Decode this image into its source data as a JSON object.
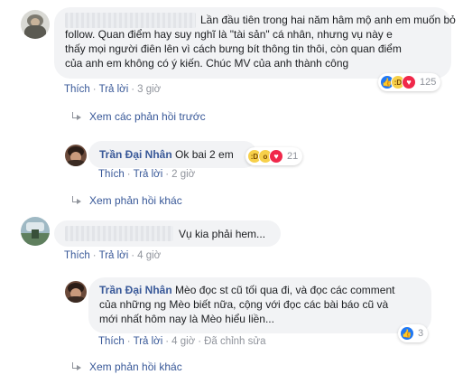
{
  "comment1": {
    "text": "Lần đầu tiên trong hai năm hâm mộ anh em muốn bỏ follow. Quan điểm hay suy nghĩ là \"tài sản\" cá nhân, nhưng vụ này e thấy mọi người điên lên vì cách bưng bít thông tin thôi, còn quan điểm của anh em không có ý kiến. Chúc MV của anh thành công",
    "line1": "Lần đầu tiên trong hai năm hâm mộ anh em muốn bỏ",
    "line2": "follow. Quan điểm hay suy nghĩ là \"tài sản\" cá nhân, nhưng vụ này e",
    "line3": "thấy mọi người điên lên vì cách bưng bít thông tin thôi, còn quan điểm",
    "line4": "của anh em không có ý kiến. Chúc MV của anh thành công",
    "like": "Thích",
    "reply": "Trả lời",
    "time": "3 giờ",
    "reactions": [
      "like",
      "haha",
      "love"
    ],
    "reaction_count": "125",
    "view_previous": "Xem các phản hồi trước"
  },
  "reply1": {
    "author": "Trần Đại Nhân",
    "text": "Ok bai 2 em",
    "like": "Thích",
    "reply": "Trả lời",
    "time": "2 giờ",
    "reactions": [
      "haha",
      "wow",
      "love"
    ],
    "reaction_count": "21",
    "view_more": "Xem phản hồi khác"
  },
  "comment2": {
    "text": "Vụ kia phải hem...",
    "like": "Thích",
    "reply": "Trả lời",
    "time": "4 giờ"
  },
  "reply2": {
    "author": "Trần Đại Nhân",
    "line1": "Mèo đọc st cũ tối qua đi, và đọc các comment",
    "line2": "của những ng Mèo biết nữa, cộng với đọc các bài báo cũ và",
    "line3": "mới nhất hôm nay là Mèo hiểu liền...",
    "like": "Thích",
    "reply": "Trả lời",
    "time": "4 giờ",
    "edited": "Đã chỉnh sửa",
    "reactions": [
      "like"
    ],
    "reaction_count": "3",
    "view_more": "Xem phản hồi khác"
  },
  "colors": {
    "link": "#385898",
    "muted": "#90949c",
    "bubble": "#f2f3f5",
    "like_blue": "#2078f4",
    "love_red": "#f0284a",
    "haha_yellow": "#f7d04a"
  }
}
